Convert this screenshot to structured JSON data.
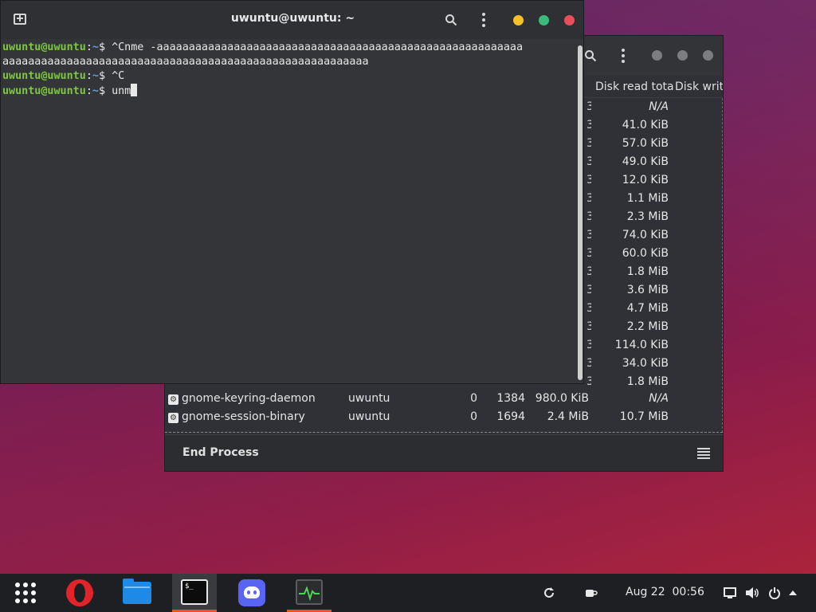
{
  "terminal": {
    "title": "uwuntu@uwuntu: ~",
    "lines": [
      {
        "user": "uwuntu@uwuntu",
        "sep": ":",
        "path": "~",
        "suffix": "$ ",
        "command": "^Cnme -aaaaaaaaaaaaaaaaaaaaaaaaaaaaaaaaaaaaaaaaaaaaaaaaaaaaaaaaa"
      },
      {
        "continuation": "aaaaaaaaaaaaaaaaaaaaaaaaaaaaaaaaaaaaaaaaaaaaaaaaaaaaaaaaa"
      },
      {
        "user": "uwuntu@uwuntu",
        "sep": ":",
        "path": "~",
        "suffix": "$ ",
        "command": "^C"
      },
      {
        "user": "uwuntu@uwuntu",
        "sep": ":",
        "path": "~",
        "suffix": "$ ",
        "command": "unm"
      }
    ],
    "icons": {
      "new_tab": "new-tab-icon",
      "search": "search-icon",
      "menu": "kebab-menu-icon"
    },
    "controls": {
      "minimize_color": "#f4c02c",
      "maximize_color": "#3cba7a",
      "close_color": "#e94f59"
    }
  },
  "system_monitor": {
    "columns": {
      "disk_read": "Disk read tota",
      "disk_write": "Disk writ"
    },
    "edge_glyph": "3",
    "disk_read_values": [
      "N/A",
      "41.0 KiB",
      "57.0 KiB",
      "49.0 KiB",
      "12.0 KiB",
      "1.1 MiB",
      "2.3 MiB",
      "74.0 KiB",
      "60.0 KiB",
      "1.8 MiB",
      "3.6 MiB",
      "4.7 MiB",
      "2.2 MiB",
      "114.0 KiB",
      "34.0 KiB",
      "1.8 MiB"
    ],
    "processes": [
      {
        "name": "gnome-keyring-daemon",
        "user": "uwuntu",
        "cpu": "0",
        "id": "1384",
        "memory": "980.0 KiB",
        "disk_read": "N/A"
      },
      {
        "name": "gnome-session-binary",
        "user": "uwuntu",
        "cpu": "0",
        "id": "1694",
        "memory": "2.4 MiB",
        "disk_read": "10.7 MiB"
      }
    ],
    "end_process_label": "End Process"
  },
  "taskbar": {
    "apps": [
      "show-apps-icon",
      "opera-icon",
      "files-icon",
      "terminal-icon",
      "discord-icon",
      "system-monitor-icon"
    ],
    "terminal_badge": "$_",
    "date": "Aug 22",
    "time": "00:56",
    "accent": "#e95420"
  }
}
